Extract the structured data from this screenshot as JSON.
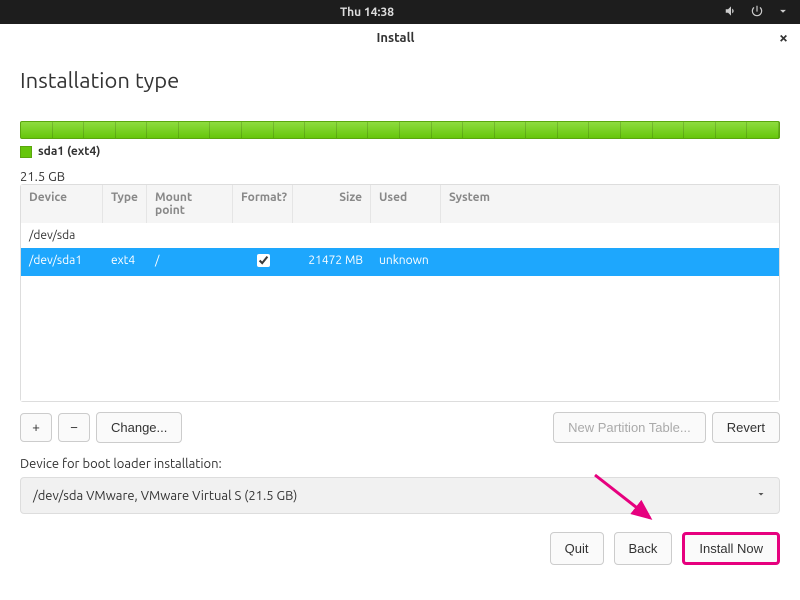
{
  "topbar": {
    "datetime": "Thu 14:38"
  },
  "window": {
    "title": "Install"
  },
  "page": {
    "heading": "Installation type"
  },
  "legend": {
    "device_label": "sda1 (ext4)",
    "size": "21.5 GB"
  },
  "table": {
    "headers": {
      "device": "Device",
      "type": "Type",
      "mount": "Mount point",
      "format": "Format?",
      "size": "Size",
      "used": "Used",
      "system": "System"
    },
    "rows": [
      {
        "device": "/dev/sda",
        "type": "",
        "mount": "",
        "format": false,
        "size": "",
        "used": "",
        "system": ""
      },
      {
        "device": "/dev/sda1",
        "type": "ext4",
        "mount": "/",
        "format": true,
        "size": "21472 MB",
        "used": "unknown",
        "system": ""
      }
    ]
  },
  "toolbar": {
    "add": "+",
    "remove": "−",
    "change": "Change...",
    "new_table": "New Partition Table...",
    "revert": "Revert"
  },
  "bootloader": {
    "label": "Device for boot loader installation:",
    "value": "/dev/sda   VMware, VMware Virtual S (21.5 GB)"
  },
  "footer": {
    "quit": "Quit",
    "back": "Back",
    "install": "Install Now"
  }
}
